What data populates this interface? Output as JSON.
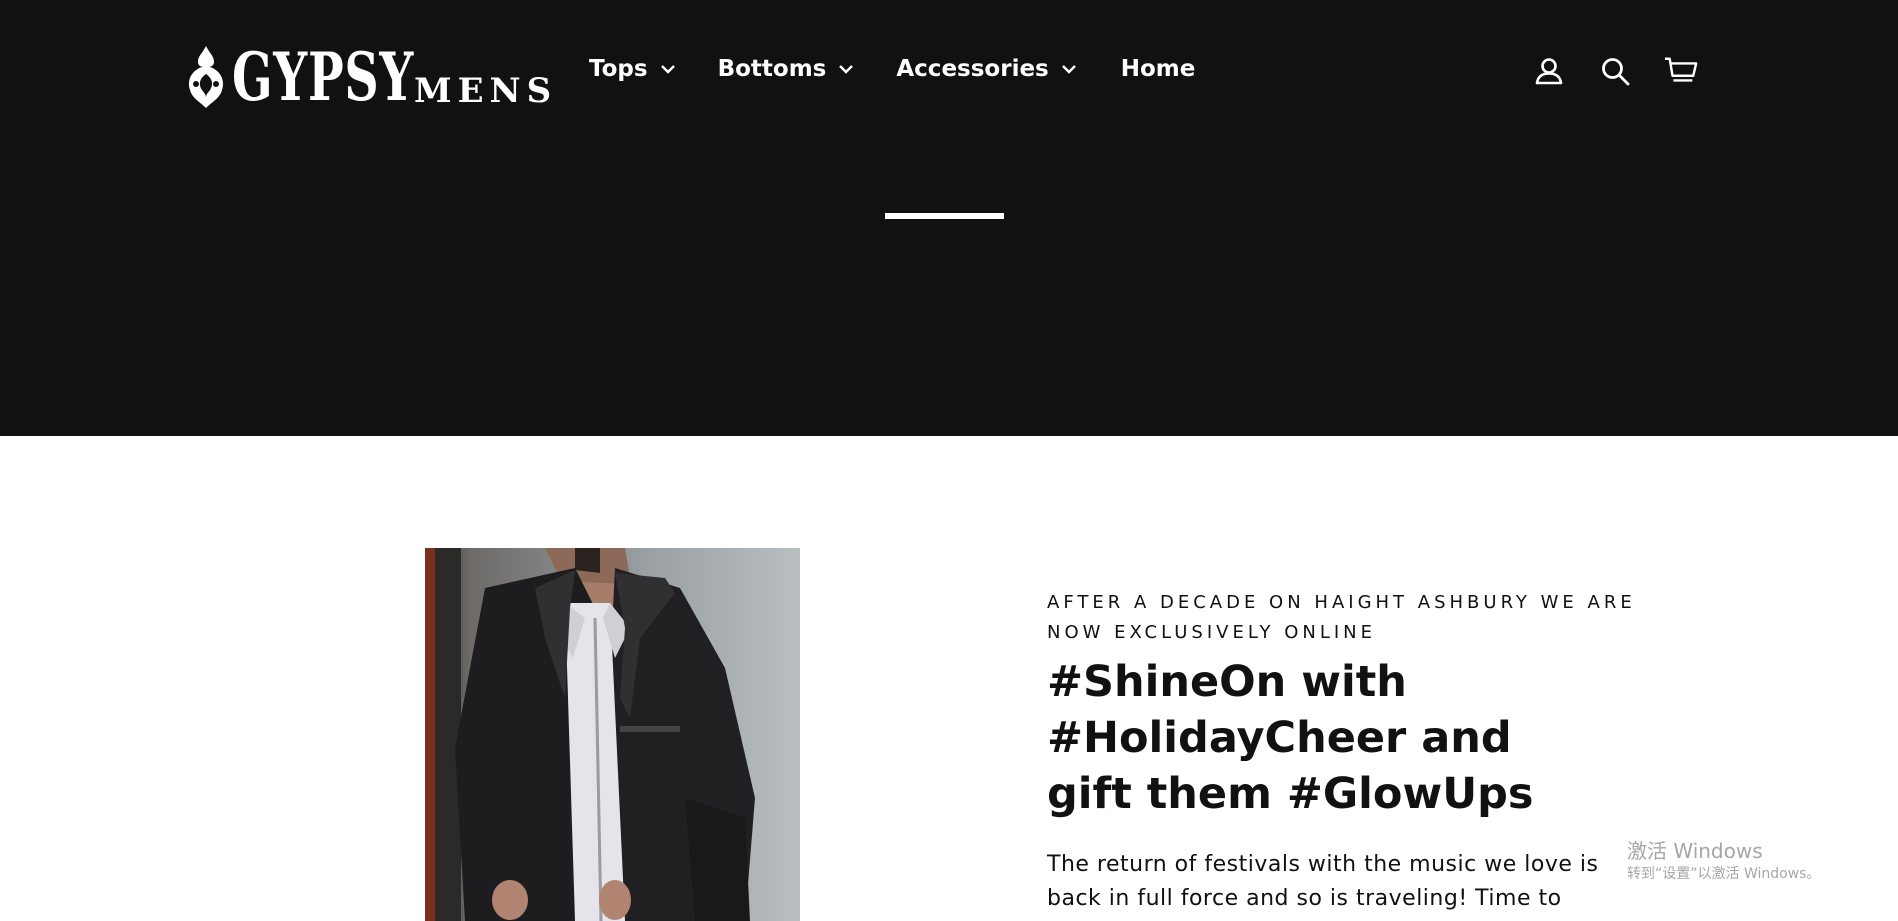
{
  "brand": {
    "logo_main": "GYPSY",
    "logo_sub": "MENS"
  },
  "nav": {
    "items": [
      {
        "label": "Tops",
        "has_dropdown": true
      },
      {
        "label": "Bottoms",
        "has_dropdown": true
      },
      {
        "label": "Accessories",
        "has_dropdown": true
      },
      {
        "label": "Home",
        "has_dropdown": false
      }
    ]
  },
  "header_icons": [
    "user-icon",
    "search-icon",
    "cart-icon"
  ],
  "feature": {
    "eyebrow": "AFTER A DECADE ON HAIGHT ASHBURY WE ARE NOW EXCLUSIVELY ONLINE",
    "headline": "#ShineOn with #HolidayCheer and gift them #GlowUps",
    "body": "The return of festivals with the music we love is back in full force and so is traveling! Time to"
  },
  "watermark": {
    "title": "激活 Windows",
    "subtitle": "转到“设置”以激活 Windows。"
  },
  "colors": {
    "header_bg": "#111111",
    "page_bg": "#ffffff",
    "text": "#111111",
    "watermark": "#a6a6a6"
  }
}
